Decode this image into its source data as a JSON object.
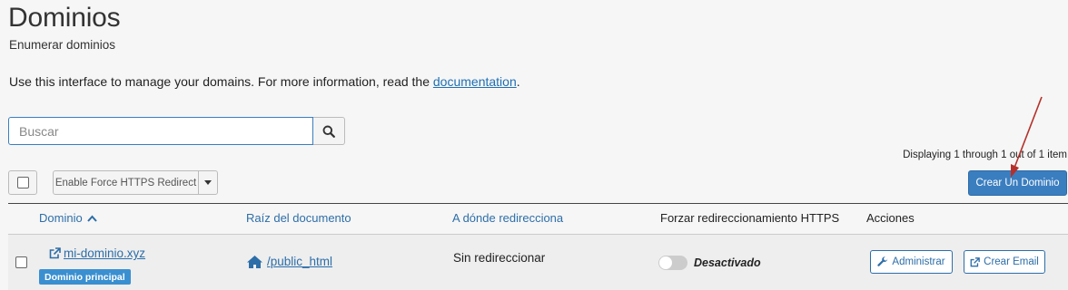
{
  "page": {
    "title": "Dominios",
    "subtitle": "Enumerar dominios",
    "intro_text": "Use this interface to manage your domains. For more information, read the ",
    "intro_link": "documentation",
    "intro_end": "."
  },
  "search": {
    "placeholder": "Buscar",
    "value": "",
    "icon": "search-icon"
  },
  "pagination": {
    "text": "Displaying 1 through 1 out of 1 item"
  },
  "toolbar": {
    "force_https_label": "Enable Force HTTPS Redirect",
    "create_domain_label": "Crear Un Dominio"
  },
  "table": {
    "headers": {
      "domain": "Dominio",
      "docroot": "Raíz del documento",
      "redirect": "A dónde redirecciona",
      "force_https": "Forzar redireccionamiento HTTPS",
      "actions": "Acciones"
    },
    "rows": [
      {
        "domain": "mi-dominio.xyz",
        "badge": "Dominio principal",
        "docroot": "/public_html",
        "redirect": "Sin redireccionar",
        "https_status": "Desactivado",
        "https_enabled": false,
        "manage_label": "Administrar",
        "email_label": "Crear Email"
      }
    ]
  },
  "colors": {
    "accent": "#3a7ec0",
    "link": "#2d6ea8",
    "badge": "#3a8fd0",
    "annotation_arrow": "#b5302a"
  }
}
